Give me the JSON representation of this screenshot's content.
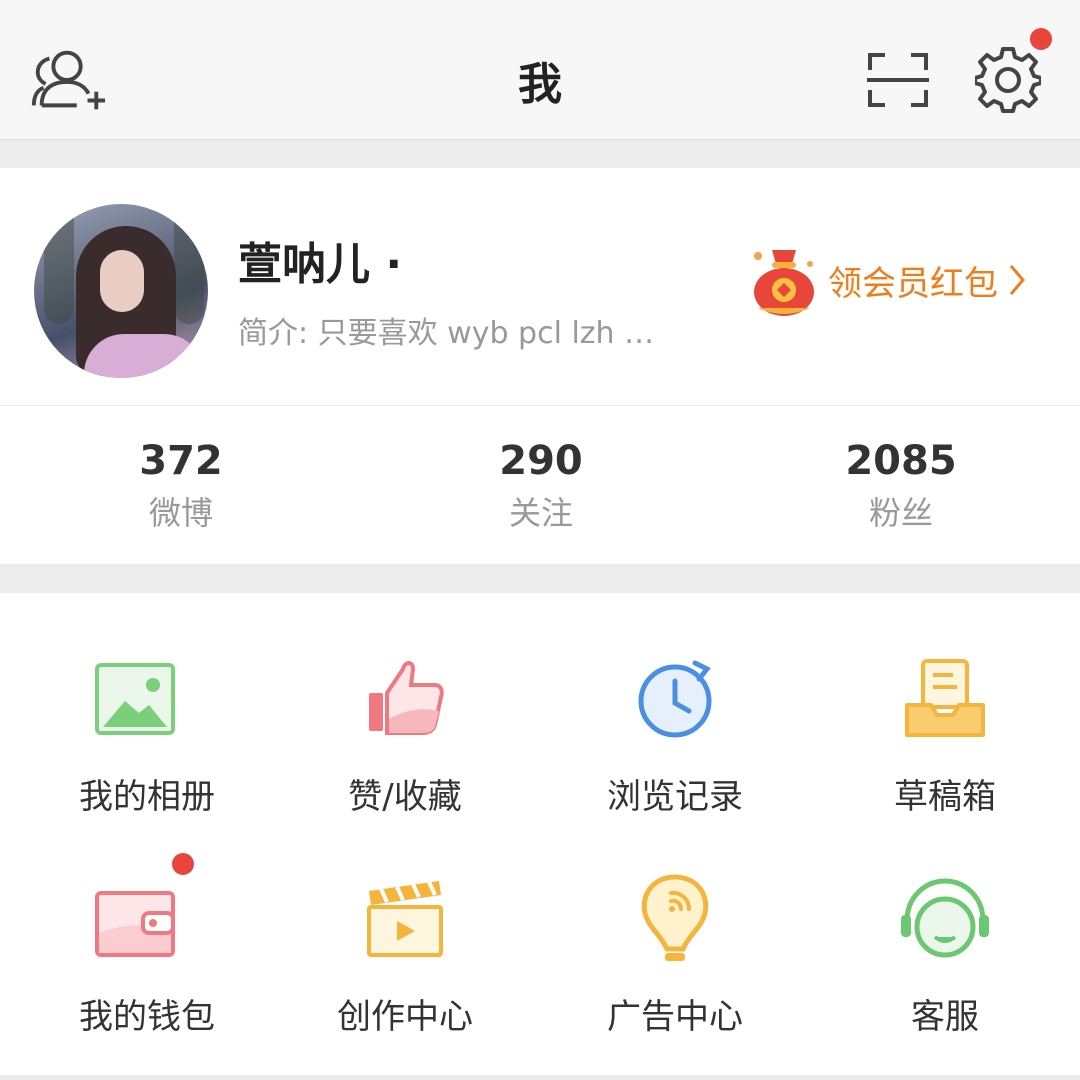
{
  "header": {
    "title": "我",
    "add_friend_icon": "add-user-icon",
    "scan_icon": "scan-icon",
    "settings_icon": "gear-icon",
    "settings_badge_color": "#e8463a"
  },
  "profile": {
    "name": "萱呐儿 ·",
    "bio": "简介: 只要喜欢 wyb pcl lzh …",
    "promo_label": "领会员红包",
    "promo_color": "#f07c1a"
  },
  "stats": [
    {
      "value": "372",
      "label": "微博"
    },
    {
      "value": "290",
      "label": "关注"
    },
    {
      "value": "2085",
      "label": "粉丝"
    }
  ],
  "menu": [
    {
      "label": "我的相册",
      "icon": "album-icon"
    },
    {
      "label": "赞/收藏",
      "icon": "thumbs-up-icon"
    },
    {
      "label": "浏览记录",
      "icon": "history-icon"
    },
    {
      "label": "草稿箱",
      "icon": "drafts-icon"
    },
    {
      "label": "我的钱包",
      "icon": "wallet-icon"
    },
    {
      "label": "创作中心",
      "icon": "clapperboard-icon"
    },
    {
      "label": "广告中心",
      "icon": "lightbulb-icon"
    },
    {
      "label": "客服",
      "icon": "headset-icon"
    }
  ]
}
